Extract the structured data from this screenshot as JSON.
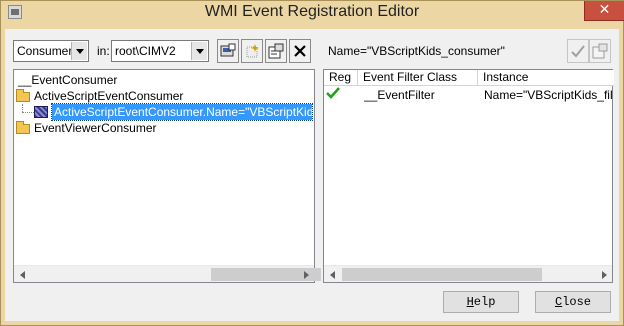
{
  "window": {
    "title": "WMI Event Registration Editor",
    "close_glyph": "✕"
  },
  "toolbar": {
    "type_select": {
      "value": "Consumers"
    },
    "in_label": "in:",
    "namespace_select": {
      "value": "root\\CIMV2"
    }
  },
  "tree": {
    "items": [
      {
        "label": "__EventConsumer",
        "icon": "none"
      },
      {
        "label": "ActiveScriptEventConsumer",
        "icon": "folder-icon"
      },
      {
        "label": "ActiveScriptEventConsumer.Name=\"VBScriptKids_consumer\"",
        "icon": "consumer-instance-icon",
        "selected": true
      },
      {
        "label": "EventViewerConsumer",
        "icon": "folder-icon"
      }
    ]
  },
  "details": {
    "name": "Name=\"VBScriptKids_consumer\"",
    "columns": [
      "Reg",
      "Event Filter Class",
      "Instance"
    ],
    "rows": [
      {
        "reg": "check-icon",
        "filter_class": "__EventFilter",
        "instance": "Name=\"VBScriptKids_filter\""
      }
    ]
  },
  "buttons": {
    "help_mnemonic": "H",
    "help_rest": "elp",
    "close_mnemonic": "C",
    "close_rest": "lose"
  },
  "colors": {
    "title_bar": "#ecd7a4",
    "selection": "#3399ff",
    "close_button": "#c7503e",
    "check": "#1aa31a"
  }
}
